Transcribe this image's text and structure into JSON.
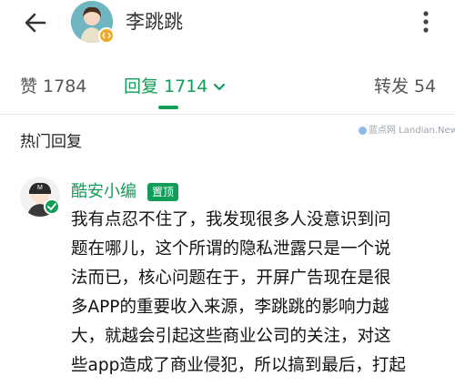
{
  "header": {
    "title": "李跳跳",
    "back_icon": "arrow-left-icon",
    "more_icon": "more-vertical-icon"
  },
  "tabs": {
    "likes_label": "赞 1784",
    "replies_label": "回复 1714",
    "shares_label": "转发 54"
  },
  "section": {
    "title": "热门回复"
  },
  "watermark": {
    "text": "蓝点网 Landian.News"
  },
  "comment": {
    "username": "酷安小编",
    "badge": "置顶",
    "lines": [
      "我有点忍不住了，我发现很多人没意识到问",
      "题在哪儿，这个所谓的隐私泄露只是一个说",
      "法而已，核心问题在于，开屏广告现在是很",
      "多APP的重要收入来源，李跳跳的影响力越",
      "大，就越会引起这些商业公司的关注，对这",
      "些app造成了商业侵犯，所以搞到最后，打起"
    ]
  },
  "colors": {
    "accent_green": "#109d58",
    "text_dark": "#222222",
    "text_muted": "#555555"
  }
}
